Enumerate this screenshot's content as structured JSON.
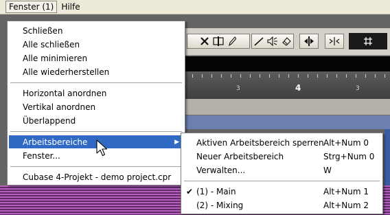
{
  "menubar": {
    "items": [
      {
        "label": "Fenster (1)",
        "open": true
      },
      {
        "label": "Hilfe",
        "open": false
      }
    ]
  },
  "menu": {
    "items": [
      {
        "label": "Schließen"
      },
      {
        "label": "Alle schließen"
      },
      {
        "label": "Alle minimieren"
      },
      {
        "label": "Alle wiederherstellen"
      },
      {
        "label": "Horizontal anordnen"
      },
      {
        "label": "Vertikal anordnen"
      },
      {
        "label": "Überlappend"
      },
      {
        "label": "Arbeitsbereiche",
        "has_submenu": true,
        "highlighted": true
      },
      {
        "label": "Fenster..."
      },
      {
        "label": "Cubase 4-Projekt - demo project.cpr"
      }
    ]
  },
  "submenu": {
    "items": [
      {
        "label": "Aktiven Arbeitsbereich sperren",
        "shortcut": "Alt+Num 0"
      },
      {
        "label": "Neuer Arbeitsbereich",
        "shortcut": "Strg+Num 0"
      },
      {
        "label": "Verwalten...",
        "shortcut": "W"
      },
      {
        "label": "(1) - Main",
        "shortcut": "Alt+Num 1",
        "checked": true
      },
      {
        "label": "(2) - Mixing",
        "shortcut": "Alt+Num 2"
      }
    ]
  },
  "ruler": {
    "labels": [
      "3",
      "4",
      "3"
    ]
  },
  "toolbar": {
    "icons": [
      "close-x-icon",
      "split-icon",
      "pencil-icon",
      "line-tool-icon",
      "speaker-icon",
      "eraser-icon",
      "nudge-icon",
      "arrows-icon",
      "grid-icon"
    ]
  },
  "colors": {
    "menubar": "#ece9d8",
    "highlight": "#316ac5",
    "timeline_blue": "#6b7fb0",
    "track_purple": "#b85fc2"
  }
}
